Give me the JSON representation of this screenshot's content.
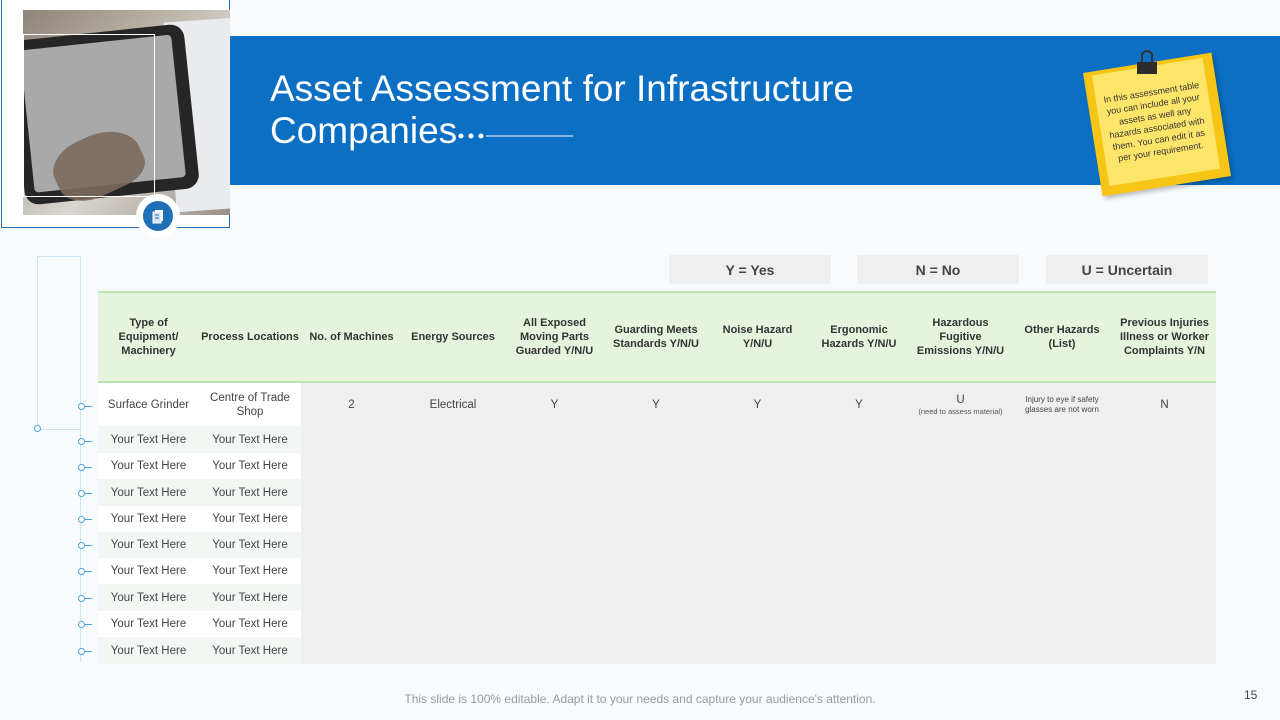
{
  "title": {
    "line1": "Asset Assessment for Infrastructure",
    "line2": "Companies"
  },
  "note": {
    "text": "In this assessment table you can include all your assets as well any hazards associated with them. You can edit it as per your requirement."
  },
  "legend": [
    "Y = Yes",
    "N = No",
    "U = Uncertain"
  ],
  "table": {
    "headers": [
      "Type of Equipment/ Machinery",
      "Process Locations",
      "No. of Machines",
      "Energy Sources",
      "All Exposed Moving Parts Guarded Y/N/U",
      "Guarding Meets Standards Y/N/U",
      "Noise Hazard Y/N/U",
      "Ergonomic Hazards Y/N/U",
      "Hazardous Fugitive Emissions Y/N/U",
      "Other Hazards (List)",
      "Previous Injuries Illness or Worker Complaints Y/N"
    ],
    "first_row": {
      "equipment": "Surface Grinder",
      "location": "Centre of Trade Shop",
      "machines": "2",
      "energy": "Electrical",
      "moving_parts": "Y",
      "guarding": "Y",
      "noise": "Y",
      "ergonomic": "Y",
      "emissions": "U",
      "emissions_note": "(need to assess material)",
      "other": "Injury to eye if safety glasses are not worn",
      "injuries": "N"
    },
    "placeholder_rows": [
      [
        "Your Text Here",
        "Your Text Here"
      ],
      [
        "Your Text Here",
        "Your Text Here"
      ],
      [
        "Your Text Here",
        "Your Text Here"
      ],
      [
        "Your Text Here",
        "Your Text Here"
      ],
      [
        "Your Text Here",
        "Your Text Here"
      ],
      [
        "Your Text Here",
        "Your Text Here"
      ],
      [
        "Your Text Here",
        "Your Text Here"
      ],
      [
        "Your Text Here",
        "Your Text Here"
      ],
      [
        "Your Text Here",
        "Your Text Here"
      ]
    ]
  },
  "footer": "This slide is 100% editable. Adapt it to your needs and capture your audience's attention.",
  "page_number": "15",
  "colors": {
    "banner": "#0b6fc4",
    "header_green": "#e6f4de",
    "note_yellow": "#f7c515"
  }
}
